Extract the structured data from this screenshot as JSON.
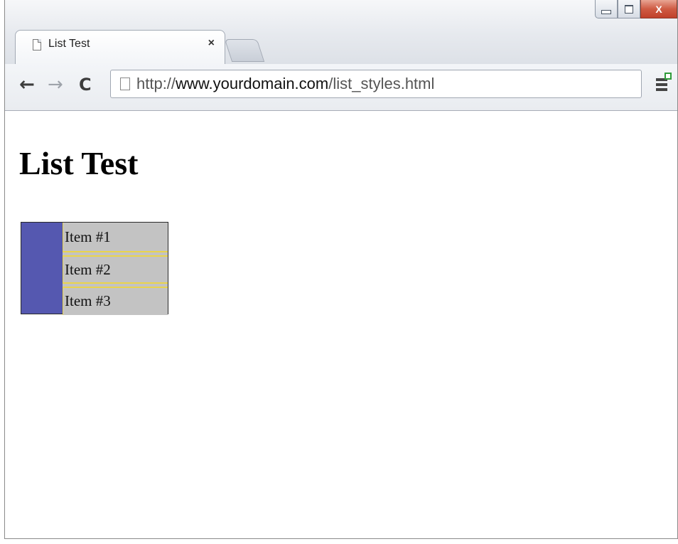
{
  "tab": {
    "title": "List Test",
    "close_glyph": "×",
    "favicon": "page-icon"
  },
  "window_controls": {
    "close_glyph": "X"
  },
  "toolbar": {
    "back_glyph": "←",
    "forward_glyph": "→",
    "reload_glyph": "C",
    "menu_icon": "chrome-menu-icon"
  },
  "address_bar": {
    "scheme": "http://",
    "host": "www.yourdomain.com",
    "path": "/list_styles.html"
  },
  "page": {
    "heading": "List Test",
    "list_items": [
      "Item #1",
      "Item #2",
      "Item #3"
    ],
    "colors": {
      "list_background": "#5558b0",
      "item_background": "#c3c3c3",
      "item_border": "#e9d44c"
    }
  }
}
